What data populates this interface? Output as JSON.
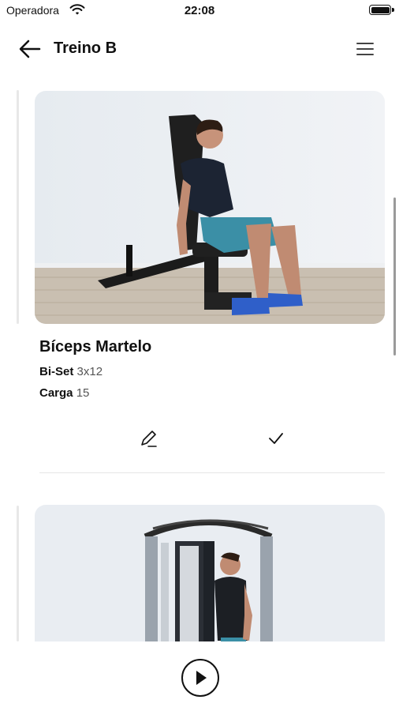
{
  "status_bar": {
    "carrier": "Operadora",
    "time": "22:08"
  },
  "header": {
    "title": "Treino B"
  },
  "exercises": [
    {
      "name": "Bíceps Martelo",
      "set_label": "Bi-Set",
      "set_value": "3x12",
      "load_label": "Carga",
      "load_value": "15"
    }
  ],
  "icons": {
    "back": "arrow-left-icon",
    "menu": "hamburger-menu-icon",
    "edit": "pencil-icon",
    "check": "check-icon",
    "play": "play-icon"
  },
  "colors": {
    "accent": "#111111",
    "background": "#ffffff",
    "divider": "#e6e6e6"
  }
}
